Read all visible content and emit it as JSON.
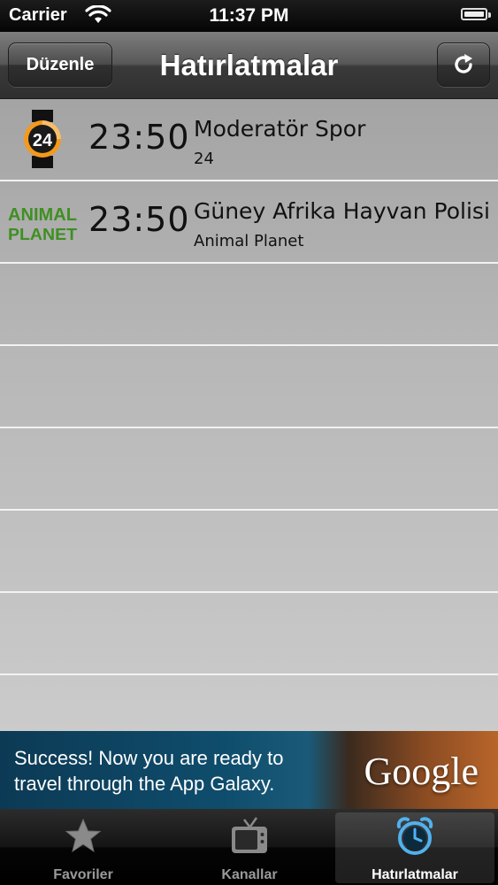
{
  "status_bar": {
    "carrier": "Carrier",
    "time": "11:37 PM"
  },
  "nav": {
    "edit_label": "Düzenle",
    "title": "Hatırlatmalar",
    "refresh_icon": "refresh-icon"
  },
  "reminders": [
    {
      "time": "23:50",
      "title": "Moderatör Spor",
      "channel": "24",
      "logo": "channel-24-logo",
      "logo_text": "24"
    },
    {
      "time": "23:50",
      "title": "Güney Afrika Hayvan Polisi",
      "channel": "Animal Planet",
      "logo": "animal-planet-logo",
      "logo_text_top": "ANIMAL",
      "logo_text_bottom": "PLANET"
    }
  ],
  "ad": {
    "line1": "Success! Now you are ready to",
    "line2": "travel through the App Galaxy.",
    "brand": "Google"
  },
  "tabs": [
    {
      "label": "Favoriler",
      "icon": "star-icon",
      "active": false
    },
    {
      "label": "Kanallar",
      "icon": "tv-icon",
      "active": false
    },
    {
      "label": "Hatırlatmalar",
      "icon": "alarm-clock-icon",
      "active": true
    }
  ],
  "colors": {
    "accent_active_tab": "#4fb2ef",
    "channel24_orange": "#f39a1c",
    "animal_planet_green": "#3f8f22"
  }
}
